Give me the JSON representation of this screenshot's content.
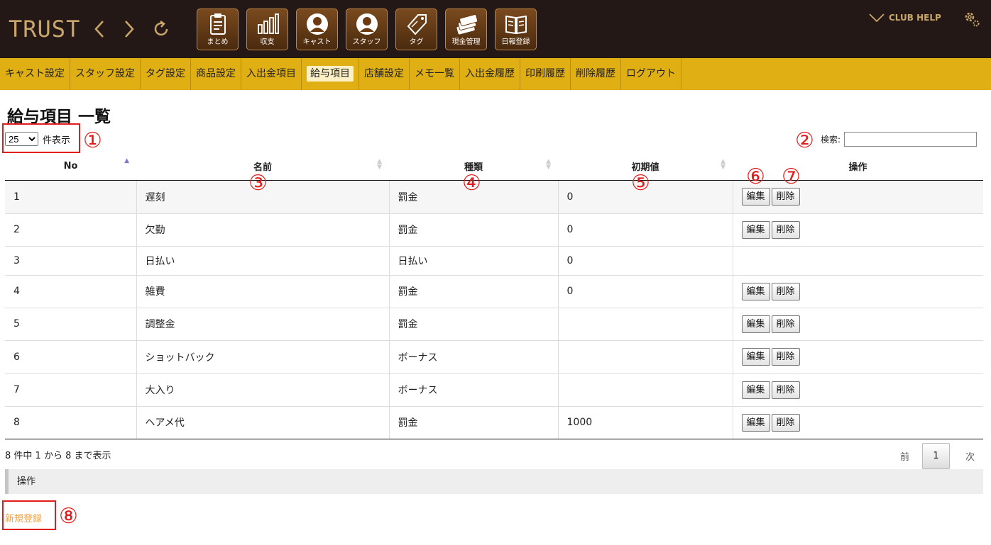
{
  "app": {
    "logo": "TRUST",
    "club_help": "CLUB HELP"
  },
  "toolbar": [
    {
      "label": "まとめ",
      "icon": "clipboard-icon"
    },
    {
      "label": "収支",
      "icon": "bar-chart-icon"
    },
    {
      "label": "キャスト",
      "icon": "cast-person-icon"
    },
    {
      "label": "スタッフ",
      "icon": "staff-person-icon"
    },
    {
      "label": "タグ",
      "icon": "tag-icon"
    },
    {
      "label": "現金管理",
      "icon": "cash-icon"
    },
    {
      "label": "日報登録",
      "icon": "book-icon"
    }
  ],
  "menu": [
    {
      "label": "キャスト設定"
    },
    {
      "label": "スタッフ設定"
    },
    {
      "label": "タグ設定"
    },
    {
      "label": "商品設定"
    },
    {
      "label": "入出金項目"
    },
    {
      "label": "給与項目",
      "active": true
    },
    {
      "label": "店舗設定"
    },
    {
      "label": "メモ一覧"
    },
    {
      "label": "入出金履歴"
    },
    {
      "label": "印刷履歴"
    },
    {
      "label": "削除履歴"
    },
    {
      "label": "ログアウト"
    }
  ],
  "page": {
    "title": "給与項目 一覧",
    "length_value": "25",
    "length_suffix": "件表示",
    "search_label": "検索:",
    "search_value": ""
  },
  "annotations": [
    "①",
    "②",
    "③",
    "④",
    "⑤",
    "⑥",
    "⑦",
    "⑧"
  ],
  "table": {
    "headers": [
      "No",
      "名前",
      "種類",
      "初期値",
      "操作"
    ],
    "edit_label": "編集",
    "delete_label": "削除",
    "rows": [
      {
        "no": "1",
        "name": "遅刻",
        "type": "罰金",
        "initial": "0",
        "actions": true
      },
      {
        "no": "2",
        "name": "欠勤",
        "type": "罰金",
        "initial": "0",
        "actions": true
      },
      {
        "no": "3",
        "name": "日払い",
        "type": "日払い",
        "initial": "0",
        "actions": false
      },
      {
        "no": "4",
        "name": "雑費",
        "type": "罰金",
        "initial": "0",
        "actions": true
      },
      {
        "no": "5",
        "name": "調整金",
        "type": "罰金",
        "initial": "",
        "actions": true
      },
      {
        "no": "6",
        "name": "ショットバック",
        "type": "ボーナス",
        "initial": "",
        "actions": true
      },
      {
        "no": "7",
        "name": "大入り",
        "type": "ボーナス",
        "initial": "",
        "actions": true
      },
      {
        "no": "8",
        "name": "ヘアメ代",
        "type": "罰金",
        "initial": "1000",
        "actions": true
      }
    ]
  },
  "footer": {
    "info": "8 件中 1 から 8 まで表示",
    "prev": "前",
    "page": "1",
    "next": "次",
    "operations_label": "操作",
    "new_link": "新規登録"
  }
}
